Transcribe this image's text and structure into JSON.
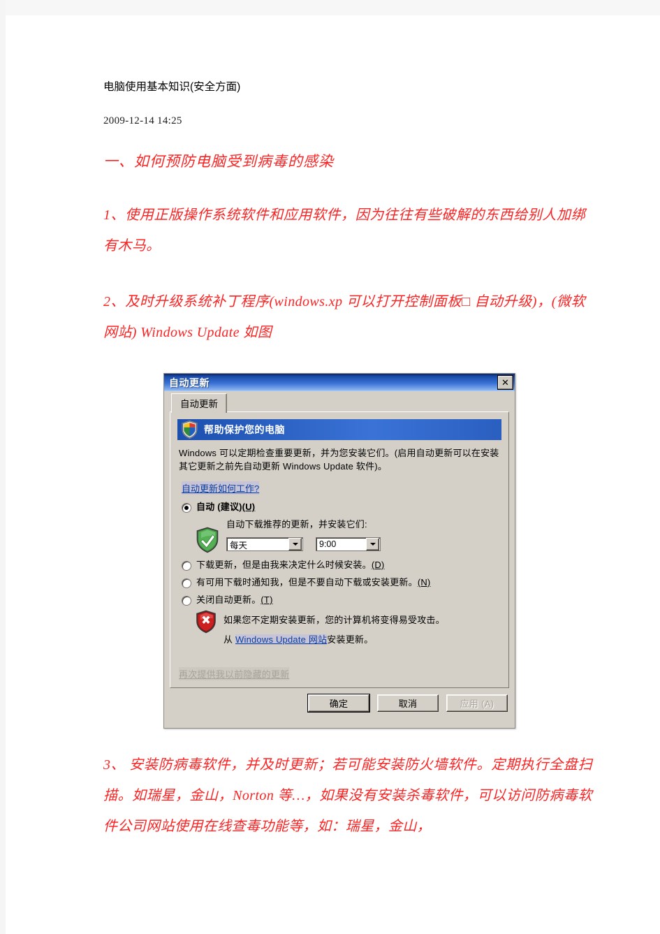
{
  "document": {
    "title": "电脑使用基本知识(安全方面)",
    "date": "2009-12-14  14:25",
    "heading": "一、如何预防电脑受到病毒的感染",
    "paragraph_1": "1、使用正版操作系统软件和应用软件，因为往往有些破解的东西给别人加绑有木马。",
    "paragraph_2": "2、及时升级系统补丁程序(windows.xp 可以打开控制面板□ 自动升级)，(微软网站) Windows  Update   如图",
    "paragraph_3": "3、 安装防病毒软件，并及时更新；若可能安装防火墙软件。定期执行全盘扫描。如瑞星，金山，Norton 等…，如果没有安装杀毒软件，可以访问防病毒软件公司网站使用在线查毒功能等，如：瑞星，金山，",
    "text_color": "#fa2424"
  },
  "dialog": {
    "title": "自动更新",
    "close_label": "✕",
    "tab_label": "自动更新",
    "banner_text": "帮助保护您的电脑",
    "description": "Windows 可以定期检查重要更新，并为您安装它们。(启用自动更新可以在安装其它更新之前先自动更新 Windows Update 软件)。",
    "help_link": "自动更新如何工作?",
    "options": [
      {
        "label": "自动 (建议)",
        "accel": "(U)",
        "selected": true,
        "bold": true
      },
      {
        "label": "下载更新，但是由我来决定什么时候安装。",
        "accel": "(D)",
        "selected": false,
        "bold": false
      },
      {
        "label": "有可用下载时通知我，但是不要自动下载或安装更新。",
        "accel": "(N)",
        "selected": false,
        "bold": false
      },
      {
        "label": "关闭自动更新。",
        "accel": "(T)",
        "selected": false,
        "bold": false
      }
    ],
    "auto_detail": {
      "sub_text": "自动下载推荐的更新，并安装它们:",
      "day_value": "每天",
      "time_value": "9:00"
    },
    "warning": {
      "line1": "如果您不定期安装更新，您的计算机将变得易受攻击。",
      "line2_prefix": "从 ",
      "line2_link": "Windows Update 网站",
      "line2_suffix": "安装更新。"
    },
    "disabled_link": "再次提供我以前隐藏的更新",
    "buttons": {
      "ok": "确定",
      "cancel": "取消",
      "apply": "应用 (A)"
    },
    "colors": {
      "titlebar_start": "#0a246a",
      "titlebar_end": "#b8d3f7",
      "face": "#d4d0c8",
      "link": "#0b3f9e"
    }
  }
}
